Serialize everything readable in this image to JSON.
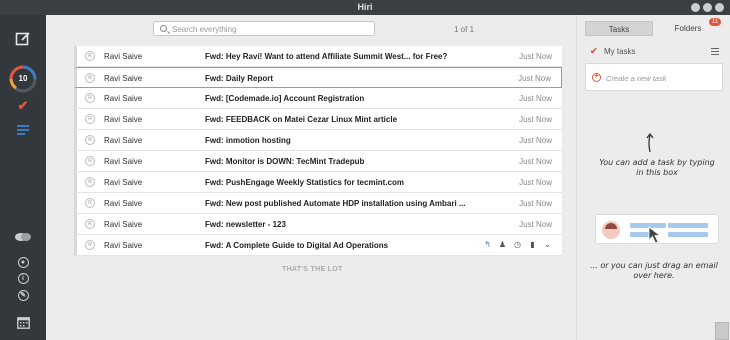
{
  "window": {
    "title": "Hiri"
  },
  "rail": {
    "badge_count": "10"
  },
  "search": {
    "placeholder": "Search everything"
  },
  "pager": {
    "text": "1 of 1"
  },
  "emails": [
    {
      "sender": "Ravi Saive",
      "subject": "Fwd: Hey Ravi! Want to attend Affiliate Summit West... for Free?",
      "time": "Just Now",
      "avatar": "R"
    },
    {
      "sender": "Ravi Saive",
      "subject": "Fwd: Daily Report",
      "time": "Just Now",
      "avatar": "R"
    },
    {
      "sender": "Ravi Saive",
      "subject": "Fwd: [Codemade.io] Account Registration",
      "time": "Just Now",
      "avatar": "R"
    },
    {
      "sender": "Ravi Saive",
      "subject": "Fwd: FEEDBACK on Matei Cezar Linux Mint article",
      "time": "Just Now",
      "avatar": "R"
    },
    {
      "sender": "Ravi Saive",
      "subject": "Fwd: inmotion hosting",
      "time": "Just Now",
      "avatar": "R"
    },
    {
      "sender": "Ravi Saive",
      "subject": "Fwd: Monitor is DOWN: TecMint Tradepub",
      "time": "Just Now",
      "avatar": "R"
    },
    {
      "sender": "Ravi Saive",
      "subject": "Fwd: PushEngage Weekly Statistics for tecmint.com",
      "time": "Just Now",
      "avatar": "R"
    },
    {
      "sender": "Ravi Saive",
      "subject": "Fwd: New post published Automate HDP installation using Ambari ...",
      "time": "Just Now",
      "avatar": "R"
    },
    {
      "sender": "Ravi Saive",
      "subject": "Fwd: newsletter - 123",
      "time": "Just Now",
      "avatar": "R"
    },
    {
      "sender": "Ravi Saive",
      "subject": "Fwd: A Complete Guide to Digital Ad Operations",
      "time": "",
      "avatar": "R"
    }
  ],
  "row_action_icons": [
    "reply-icon",
    "person-icon",
    "clock-icon",
    "trash-icon",
    "chevron-down-icon"
  ],
  "list_footer": "THAT'S THE LOT",
  "tabs": {
    "tasks": "Tasks",
    "folders": "Folders",
    "folders_badge": "11"
  },
  "tasks": {
    "header": "My tasks",
    "new_placeholder": "Create a new task",
    "hint_type": "You can add a task by typing in this box",
    "hint_drag": "... or you can just drag an email over here."
  },
  "colors": {
    "accent": "#e0573f",
    "selection": "#6aa7dc",
    "rail_bg": "#33383d",
    "blue": "#3a7dc2"
  }
}
